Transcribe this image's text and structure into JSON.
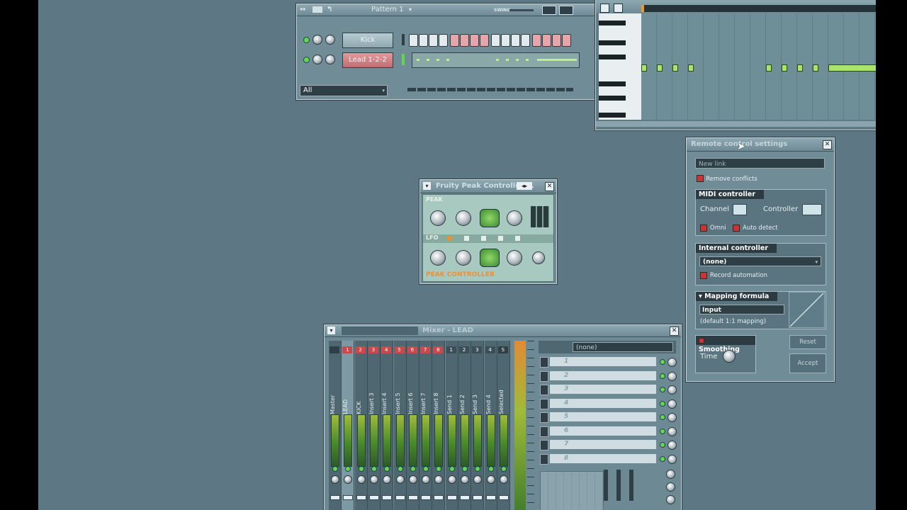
{
  "channel_rack": {
    "pattern_label": "Pattern 1",
    "swing_label": "SWING",
    "channels": [
      {
        "name": "Kick"
      },
      {
        "name": "Lead 1-2-2"
      }
    ],
    "filter_value": "All"
  },
  "peak_controller": {
    "title": "Fruity Peak Controller ...",
    "peak_label": "PEAK",
    "lfo_label": "LFO",
    "brand_label": "PEAK CONTROLLER"
  },
  "remote_control": {
    "title": "Remote control settings",
    "new_link_label": "New link",
    "remove_conflicts_label": "Remove conflicts",
    "midi_controller_title": "MIDI controller",
    "channel_label": "Channel",
    "controller_label": "Controller",
    "omni_label": "Omni",
    "auto_detect_label": "Auto detect",
    "internal_controller_title": "Internal controller",
    "internal_value": "(none)",
    "record_automation_label": "Record automation",
    "mapping_formula_title": "Mapping formula",
    "formula_value": "Input",
    "formula_hint": "(default 1:1 mapping)",
    "smoothing_title": "Smoothing",
    "time_label": "Time",
    "reset_label": "Reset",
    "accept_label": "Accept"
  },
  "mixer": {
    "title": "Mixer - LEAD",
    "effects_chain_value": "(none)",
    "tracks": [
      {
        "num": "",
        "label": "Master"
      },
      {
        "num": "1",
        "label": "LEAD"
      },
      {
        "num": "2",
        "label": "KICK"
      },
      {
        "num": "3",
        "label": "Insert 3"
      },
      {
        "num": "4",
        "label": "Insert 4"
      },
      {
        "num": "5",
        "label": "Insert 5"
      },
      {
        "num": "6",
        "label": "Insert 6"
      },
      {
        "num": "7",
        "label": "Insert 7"
      },
      {
        "num": "8",
        "label": "Insert 8"
      },
      {
        "num": "1",
        "label": "Send 1"
      },
      {
        "num": "2",
        "label": "Send 2"
      },
      {
        "num": "3",
        "label": "Send 3"
      },
      {
        "num": "4",
        "label": "Send 4"
      },
      {
        "num": "S",
        "label": "Selected"
      }
    ],
    "slots": [
      "1",
      "2",
      "3",
      "4",
      "5",
      "6",
      "7",
      "8"
    ]
  },
  "colors": {
    "workspace": "#5d7884",
    "accent_red": "#c84a4a",
    "led_green": "#62d84d",
    "note_green": "#a8e56a"
  }
}
